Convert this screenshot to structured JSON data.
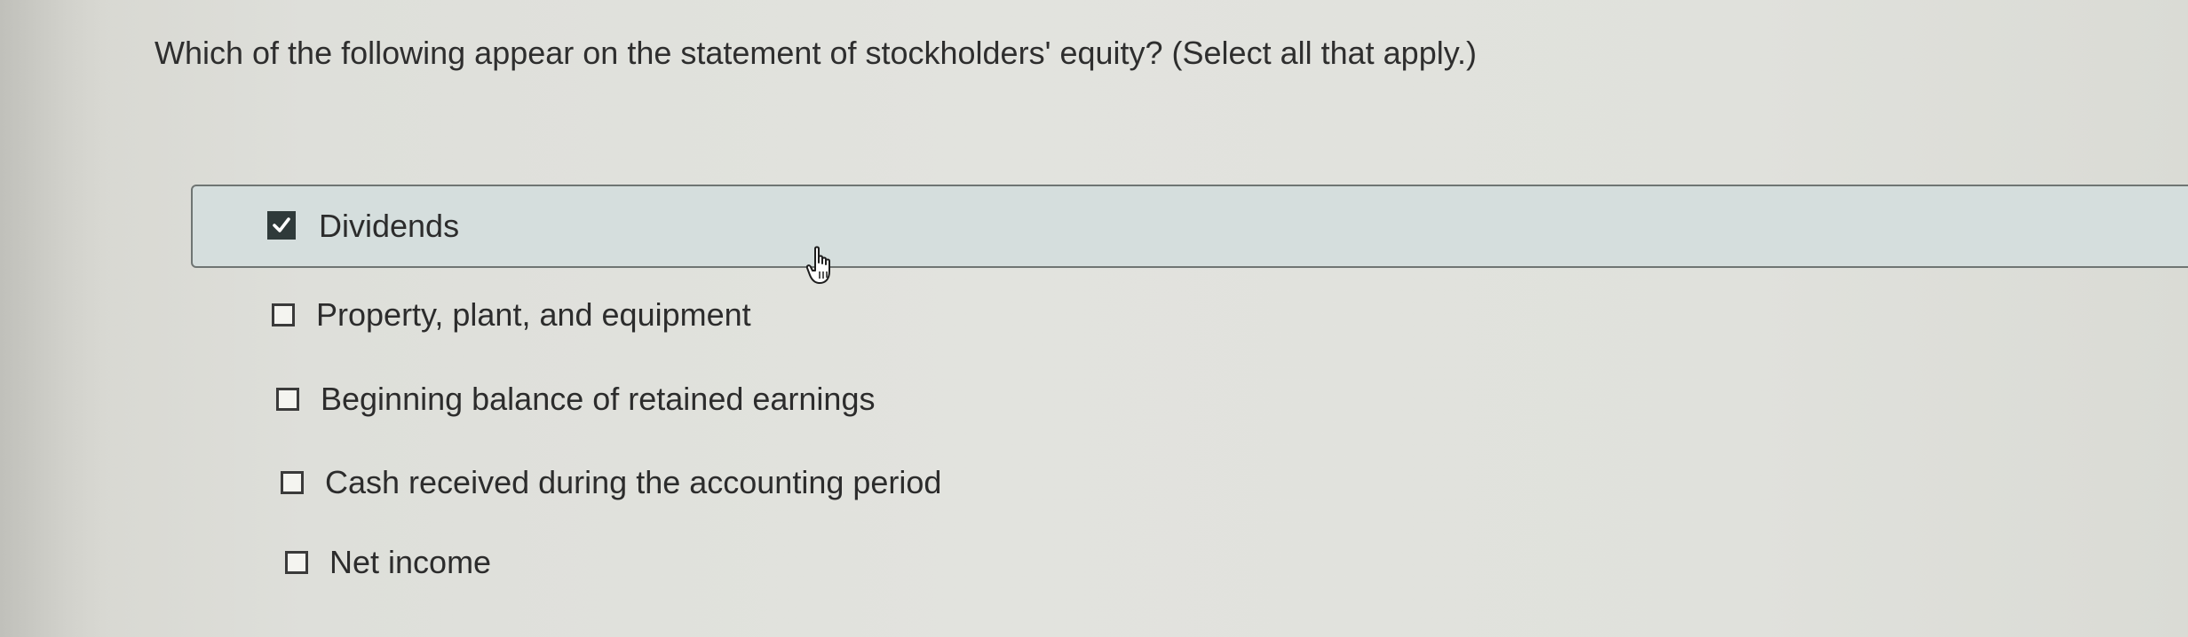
{
  "question": {
    "text": "Which of the following appear on the statement of stockholders' equity? (Select all that apply.)"
  },
  "options": [
    {
      "label": "Dividends",
      "checked": true
    },
    {
      "label": "Property, plant, and equipment",
      "checked": false
    },
    {
      "label": "Beginning balance of retained earnings",
      "checked": false
    },
    {
      "label": "Cash received during the accounting period",
      "checked": false
    },
    {
      "label": "Net income",
      "checked": false
    }
  ],
  "icons": {
    "checkmark": "checkmark-icon",
    "cursor": "hand-pointer-cursor-icon"
  },
  "colors": {
    "selected_background": "#d5dedd",
    "checkbox_checked": "#2f3a3a"
  }
}
